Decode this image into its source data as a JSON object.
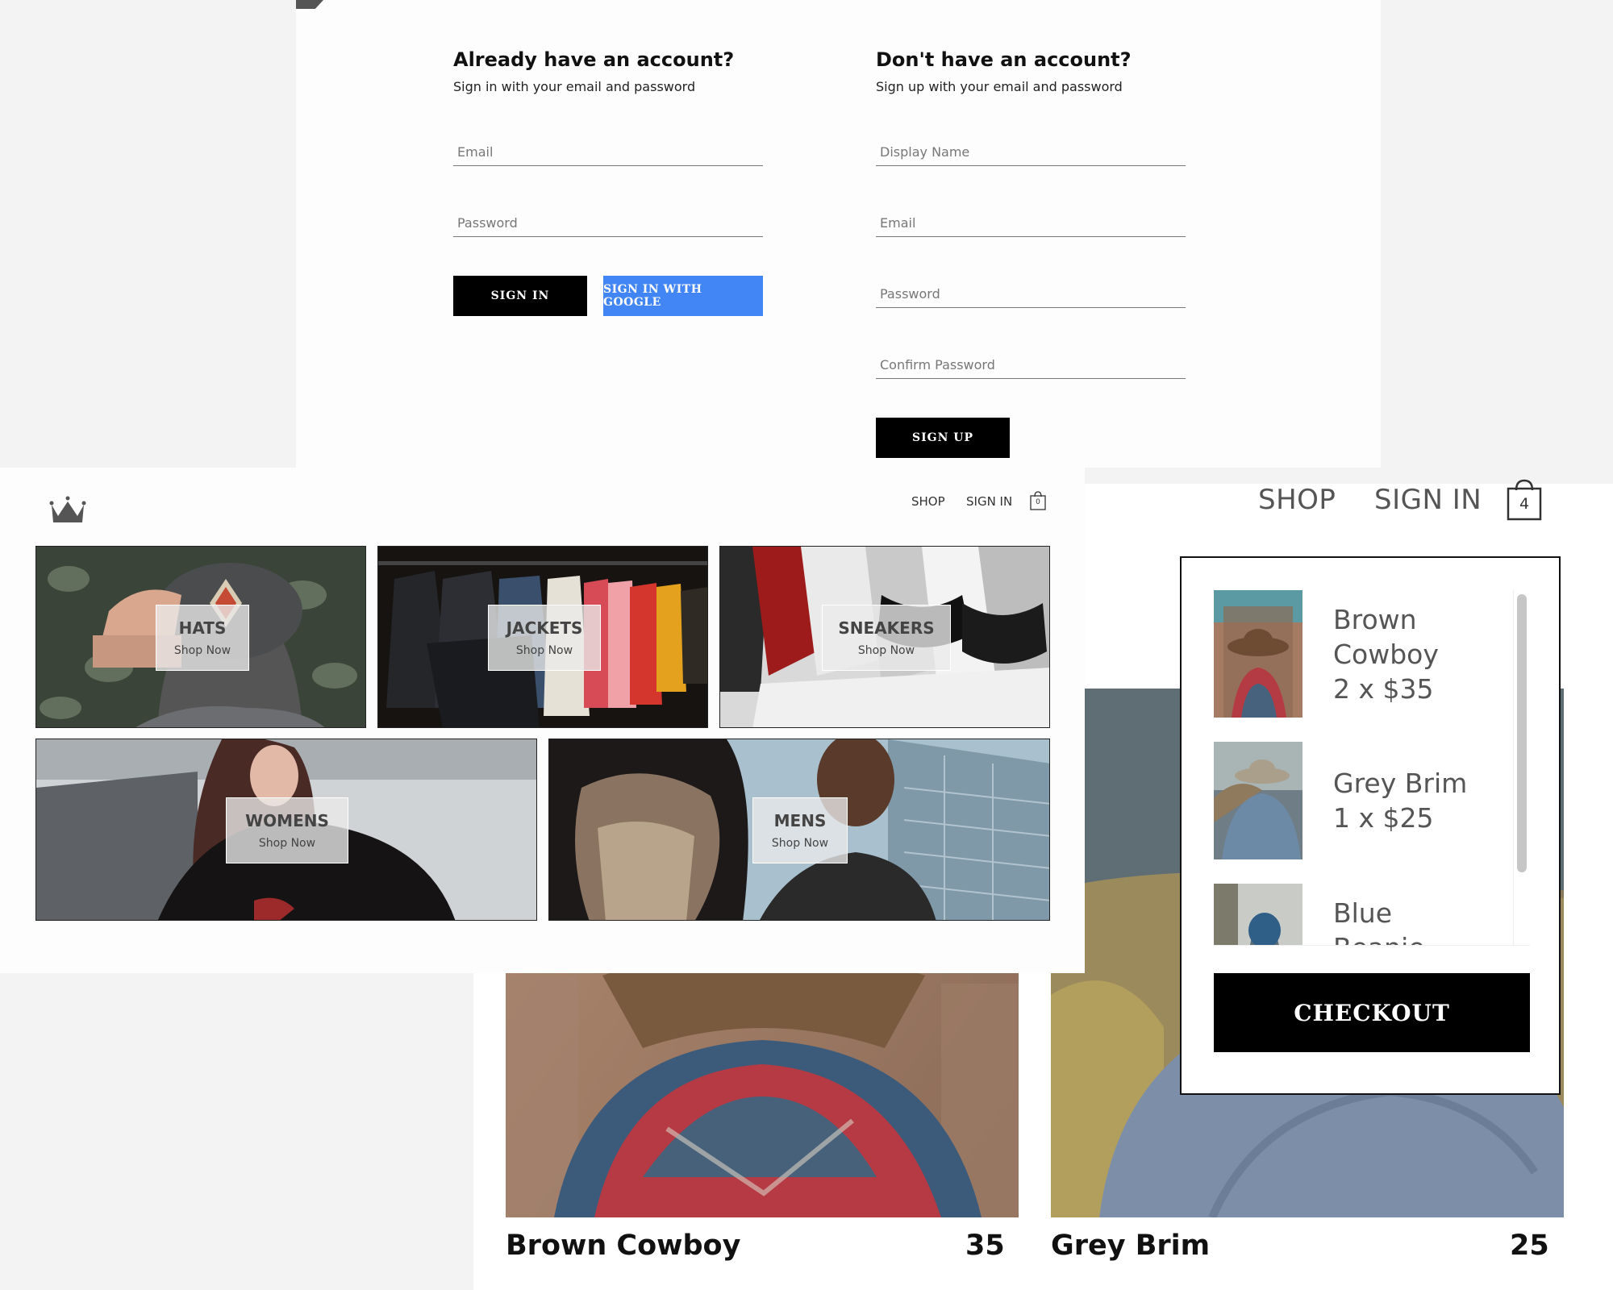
{
  "auth": {
    "signin": {
      "heading": "Already have an account?",
      "subheading": "Sign in with your email and password",
      "email_placeholder": "Email",
      "password_placeholder": "Password",
      "signin_button": "SIGN IN",
      "google_button": "SIGN IN WITH GOOGLE"
    },
    "signup": {
      "heading": "Don't have an account?",
      "subheading": "Sign up with your email and password",
      "display_name_placeholder": "Display Name",
      "email_placeholder": "Email",
      "password_placeholder": "Password",
      "confirm_password_placeholder": "Confirm Password",
      "signup_button": "SIGN UP"
    }
  },
  "home_header": {
    "nav_shop": "SHOP",
    "nav_signin": "SIGN IN",
    "cart_count": "0"
  },
  "big_header": {
    "nav_shop": "SHOP",
    "nav_signin": "SIGN IN",
    "cart_count": "4"
  },
  "categories": [
    {
      "title": "HATS",
      "cta": "Shop Now"
    },
    {
      "title": "JACKETS",
      "cta": "Shop Now"
    },
    {
      "title": "SNEAKERS",
      "cta": "Shop Now"
    },
    {
      "title": "WOMENS",
      "cta": "Shop Now"
    },
    {
      "title": "MENS",
      "cta": "Shop Now"
    }
  ],
  "cart": {
    "items": [
      {
        "name_line1": "Brown",
        "name_line2": "Cowboy",
        "qty_price": "2 x $35"
      },
      {
        "name_line1": "Grey Brim",
        "qty_price": "1 x $25"
      },
      {
        "name_line1": "Blue",
        "name_line2": "Beanie"
      }
    ],
    "checkout_label": "CHECKOUT"
  },
  "products": [
    {
      "name": "Brown Cowboy",
      "price": "35"
    },
    {
      "name": "Grey Brim",
      "price": "25"
    }
  ],
  "colors": {
    "google_blue": "#4285f4",
    "button_black": "#000000",
    "page_bg": "#f3f3f3"
  }
}
